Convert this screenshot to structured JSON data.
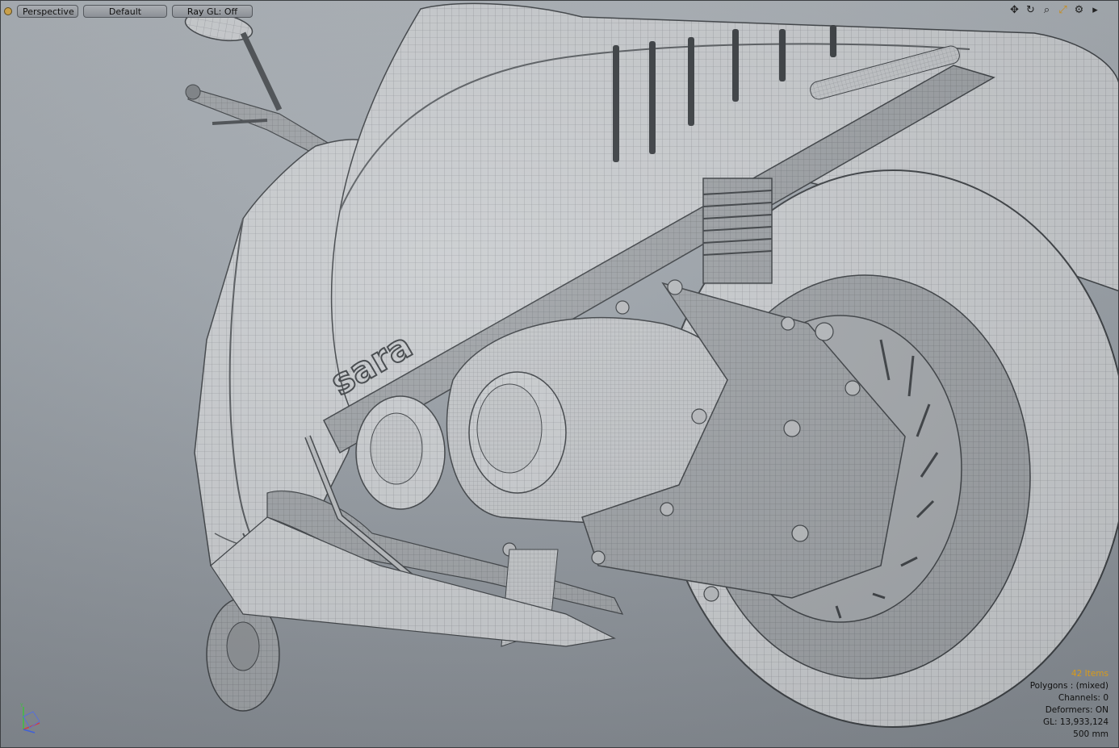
{
  "viewport": {
    "toolbar": {
      "view_mode": "Perspective",
      "shading": "Default",
      "ray_gl": "Ray GL: Off"
    },
    "nav_icons": [
      "move-view-icon",
      "rotate-view-icon",
      "zoom-view-icon",
      "fit-view-icon",
      "settings-icon",
      "expand-icon"
    ],
    "stats": {
      "items": "42 Items",
      "polygons": "Polygons : (mixed)",
      "channels": "Channels: 0",
      "deformers": "Deformers: ON",
      "gl": "GL: 13,933,124",
      "scale": "500 mm"
    },
    "model_label": "sara",
    "colors": {
      "accent": "#d99b1a",
      "background_top": "#aab0b6",
      "background_bottom": "#868c93",
      "mesh_fill": "#c9cccf",
      "wire": "#6b6f73"
    }
  }
}
